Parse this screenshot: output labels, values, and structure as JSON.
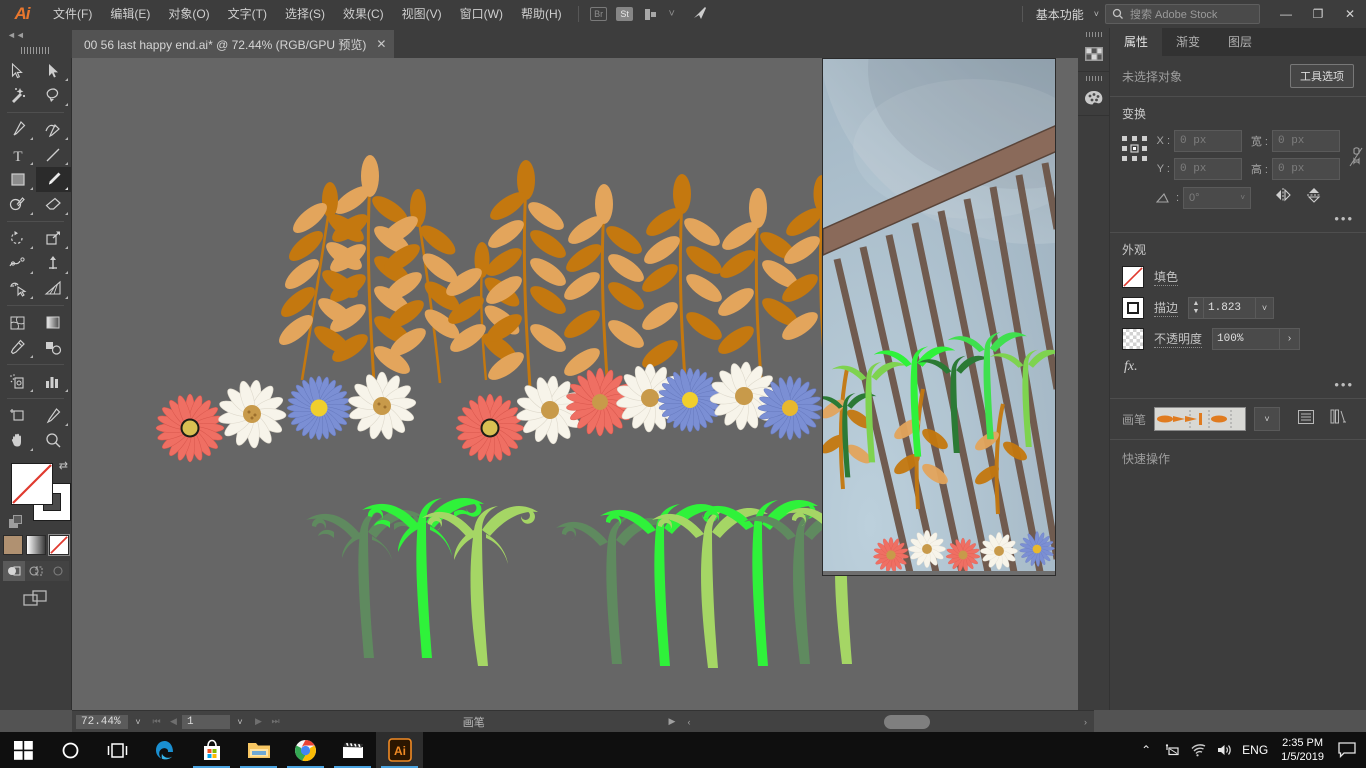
{
  "menu": {
    "logo": "Ai",
    "items": [
      {
        "label": "文件(F)",
        "name": "menu-file"
      },
      {
        "label": "编辑(E)",
        "name": "menu-edit"
      },
      {
        "label": "对象(O)",
        "name": "menu-object"
      },
      {
        "label": "文字(T)",
        "name": "menu-type"
      },
      {
        "label": "选择(S)",
        "name": "menu-select"
      },
      {
        "label": "效果(C)",
        "name": "menu-effect"
      },
      {
        "label": "视图(V)",
        "name": "menu-view"
      },
      {
        "label": "窗口(W)",
        "name": "menu-window"
      },
      {
        "label": "帮助(H)",
        "name": "menu-help"
      }
    ],
    "bridge_label": "Br",
    "stock_label": "St",
    "workspace": "基本功能",
    "search_placeholder": "搜索 Adobe Stock",
    "minimize": "—",
    "maximize": "❐",
    "close": "✕"
  },
  "tab": {
    "title": "00 56 last happy end.ai* @ 72.44% (RGB/GPU 预览)",
    "close": "✕"
  },
  "toolbar": {
    "tools": [
      {
        "name": "selection-tool",
        "title": "选择工具"
      },
      {
        "name": "direct-selection-tool",
        "title": "直接选择工具"
      },
      {
        "name": "magic-wand-tool",
        "title": "魔棒工具"
      },
      {
        "name": "lasso-tool",
        "title": "套索工具"
      },
      {
        "name": "pen-tool",
        "title": "钢笔工具"
      },
      {
        "name": "curvature-tool",
        "title": "曲率工具"
      },
      {
        "name": "type-tool",
        "title": "文字工具"
      },
      {
        "name": "line-segment-tool",
        "title": "直线段工具"
      },
      {
        "name": "rectangle-tool",
        "title": "矩形工具"
      },
      {
        "name": "paintbrush-tool",
        "title": "画笔工具"
      },
      {
        "name": "shaper-tool",
        "title": "Shaper 工具"
      },
      {
        "name": "eraser-tool",
        "title": "橡皮擦工具"
      },
      {
        "name": "rotate-tool",
        "title": "旋转工具"
      },
      {
        "name": "scale-tool",
        "title": "比例缩放工具"
      },
      {
        "name": "width-tool",
        "title": "宽度工具"
      },
      {
        "name": "free-transform-tool",
        "title": "自由变换工具"
      },
      {
        "name": "shape-builder-tool",
        "title": "形状生成器工具"
      },
      {
        "name": "perspective-grid-tool",
        "title": "透视网格工具"
      },
      {
        "name": "mesh-tool",
        "title": "网格工具"
      },
      {
        "name": "gradient-tool",
        "title": "渐变工具"
      },
      {
        "name": "eyedropper-tool",
        "title": "吸管工具"
      },
      {
        "name": "blend-tool",
        "title": "混合工具"
      },
      {
        "name": "symbol-sprayer-tool",
        "title": "符号喷枪工具"
      },
      {
        "name": "column-graph-tool",
        "title": "柱形图工具"
      },
      {
        "name": "artboard-tool",
        "title": "画板工具"
      },
      {
        "name": "slice-tool",
        "title": "切片工具"
      },
      {
        "name": "hand-tool",
        "title": "抓手工具"
      },
      {
        "name": "zoom-tool",
        "title": "缩放工具"
      }
    ],
    "active_tool": "paintbrush-tool",
    "fill_color": "#FFFFFF",
    "fill_is_none": true,
    "stroke_color": "#FFFFFF",
    "swap_icon": "swap-fill-stroke-icon",
    "mini_swatches": [
      {
        "name": "color-swatch",
        "color": "#b09171"
      },
      {
        "name": "gradient-swatch",
        "color": "#cfcfcf"
      },
      {
        "name": "none-swatch",
        "color": "#ffffff"
      }
    ],
    "selected_mini": 2,
    "draw_modes": [
      "draw-normal",
      "draw-behind",
      "draw-inside"
    ],
    "active_draw_mode": 0,
    "screen_mode": "change-screen-mode-icon"
  },
  "canvas": {
    "background": "#666666",
    "artwork": {
      "wheat_dark": "#c4780f",
      "wheat_light": "#e3a55c",
      "fern_dark": "#5f8a5f",
      "fern_bright": "#2ff23a",
      "fern_light": "#a5d665",
      "flower_red": "#ef6f63",
      "flower_white": "#f7f4ea",
      "flower_blue": "#7b8fd4",
      "flower_center_yellow": "#e6b82e",
      "flower_center_brown": "#c89a4a"
    },
    "photo": {
      "sky_color": "#aec2d0",
      "planet_color": "#8d9aa6",
      "rail_color": "#8a6a5a",
      "post_color": "#7d6356"
    }
  },
  "statusbar": {
    "zoom": "72.44%",
    "zoom_dropdown": "chevron-down-icon",
    "nav_first": "⏮",
    "nav_prev": "◀",
    "page": "1",
    "page_dropdown": "chevron-down-icon",
    "nav_next": "▶",
    "nav_last": "⏭",
    "status_text": "画笔",
    "status_arrow": "▶",
    "scroll_left": "‹",
    "scroll_right": "›"
  },
  "rail": {
    "items": [
      {
        "name": "swatches-panel-icon",
        "label": "色板"
      },
      {
        "name": "color-panel-icon",
        "label": "颜色"
      }
    ]
  },
  "properties": {
    "tabs": [
      {
        "label": "属性",
        "name": "tab-properties",
        "active": true
      },
      {
        "label": "渐变",
        "name": "tab-gradient",
        "active": false
      },
      {
        "label": "图层",
        "name": "tab-layers",
        "active": false
      }
    ],
    "selection_status": "未选择对象",
    "tool_options_button": "工具选项",
    "transform": {
      "title": "变换",
      "x_label": "X :",
      "x_value": "0 px",
      "y_label": "Y :",
      "y_value": "0 px",
      "w_label": "宽 :",
      "w_value": "0 px",
      "h_label": "高 :",
      "h_value": "0 px",
      "angle_label": "angle-icon",
      "angle_value": "0°",
      "link_icon": "link-broken-icon",
      "flip_h_icon": "flip-horizontal-icon",
      "flip_v_icon": "flip-vertical-icon",
      "more_icon": "more-options-icon"
    },
    "appearance": {
      "title": "外观",
      "fill_label": "填色",
      "fill_is_none": true,
      "stroke_label": "描边",
      "stroke_weight": "1.823",
      "opacity_label": "不透明度",
      "opacity_value": "100%",
      "fx_label": "fx.",
      "more_icon": "more-options-icon"
    },
    "brush": {
      "label": "画笔",
      "swatch_name": "brush-preview-swatch",
      "dropdown_icon": "chevron-down-icon",
      "options_icon": "brush-options-icon",
      "library_icon": "brush-libraries-icon"
    },
    "quick_actions": {
      "title": "快速操作"
    }
  },
  "taskbar": {
    "apps": [
      {
        "name": "start-button",
        "label": "Windows"
      },
      {
        "name": "cortana-search-icon",
        "label": "Cortana"
      },
      {
        "name": "task-view-icon",
        "label": "任务视图"
      },
      {
        "name": "edge-icon",
        "label": "Microsoft Edge"
      },
      {
        "name": "microsoft-store-icon",
        "label": "Microsoft Store"
      },
      {
        "name": "file-explorer-icon",
        "label": "文件资源管理器"
      },
      {
        "name": "chrome-icon",
        "label": "Google Chrome"
      },
      {
        "name": "movies-tv-icon",
        "label": "电影和电视"
      },
      {
        "name": "illustrator-icon",
        "label": "Adobe Illustrator"
      }
    ],
    "tray": {
      "show_hidden": "chevron-up-icon",
      "removable_media": "usb-eject-icon",
      "network": "wifi-icon",
      "volume": "speaker-icon",
      "language": "ENG",
      "time": "2:35 PM",
      "date": "1/5/2019",
      "action_center": "notification-icon"
    }
  }
}
